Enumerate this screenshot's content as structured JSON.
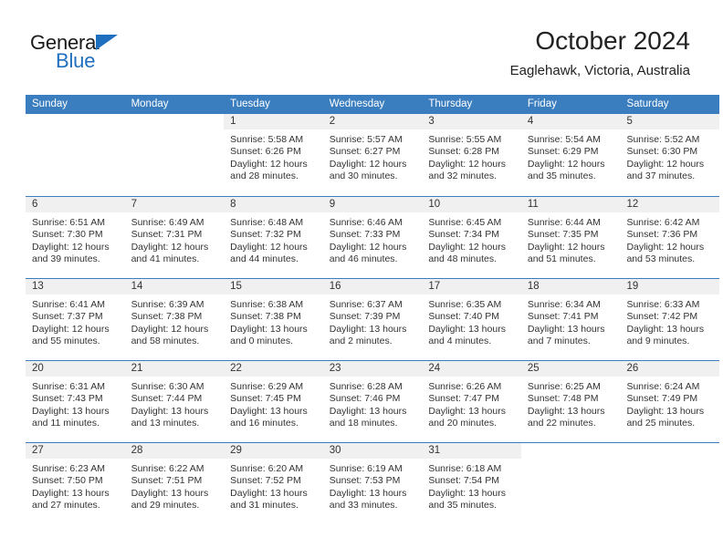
{
  "brand": {
    "name_top": "General",
    "name_bottom": "Blue",
    "triangle_icon": "blue-triangle-icon",
    "accent_color": "#1f6fc0"
  },
  "header": {
    "title": "October 2024",
    "subtitle": "Eaglehawk, Victoria, Australia"
  },
  "colors": {
    "header_blue": "#3b7ec0",
    "date_band_gray": "#f0f0f0",
    "text": "#333333"
  },
  "calendar": {
    "weekdays": [
      "Sunday",
      "Monday",
      "Tuesday",
      "Wednesday",
      "Thursday",
      "Friday",
      "Saturday"
    ],
    "labels": {
      "sunrise": "Sunrise:",
      "sunset": "Sunset:",
      "daylight": "Daylight:"
    },
    "weeks": [
      [
        {
          "day": "",
          "sunrise": "",
          "sunset": "",
          "daylight": "",
          "blank": true
        },
        {
          "day": "",
          "sunrise": "",
          "sunset": "",
          "daylight": "",
          "blank": true
        },
        {
          "day": "1",
          "sunrise": "Sunrise: 5:58 AM",
          "sunset": "Sunset: 6:26 PM",
          "daylight": "Daylight: 12 hours and 28 minutes."
        },
        {
          "day": "2",
          "sunrise": "Sunrise: 5:57 AM",
          "sunset": "Sunset: 6:27 PM",
          "daylight": "Daylight: 12 hours and 30 minutes."
        },
        {
          "day": "3",
          "sunrise": "Sunrise: 5:55 AM",
          "sunset": "Sunset: 6:28 PM",
          "daylight": "Daylight: 12 hours and 32 minutes."
        },
        {
          "day": "4",
          "sunrise": "Sunrise: 5:54 AM",
          "sunset": "Sunset: 6:29 PM",
          "daylight": "Daylight: 12 hours and 35 minutes."
        },
        {
          "day": "5",
          "sunrise": "Sunrise: 5:52 AM",
          "sunset": "Sunset: 6:30 PM",
          "daylight": "Daylight: 12 hours and 37 minutes."
        }
      ],
      [
        {
          "day": "6",
          "sunrise": "Sunrise: 6:51 AM",
          "sunset": "Sunset: 7:30 PM",
          "daylight": "Daylight: 12 hours and 39 minutes."
        },
        {
          "day": "7",
          "sunrise": "Sunrise: 6:49 AM",
          "sunset": "Sunset: 7:31 PM",
          "daylight": "Daylight: 12 hours and 41 minutes."
        },
        {
          "day": "8",
          "sunrise": "Sunrise: 6:48 AM",
          "sunset": "Sunset: 7:32 PM",
          "daylight": "Daylight: 12 hours and 44 minutes."
        },
        {
          "day": "9",
          "sunrise": "Sunrise: 6:46 AM",
          "sunset": "Sunset: 7:33 PM",
          "daylight": "Daylight: 12 hours and 46 minutes."
        },
        {
          "day": "10",
          "sunrise": "Sunrise: 6:45 AM",
          "sunset": "Sunset: 7:34 PM",
          "daylight": "Daylight: 12 hours and 48 minutes."
        },
        {
          "day": "11",
          "sunrise": "Sunrise: 6:44 AM",
          "sunset": "Sunset: 7:35 PM",
          "daylight": "Daylight: 12 hours and 51 minutes."
        },
        {
          "day": "12",
          "sunrise": "Sunrise: 6:42 AM",
          "sunset": "Sunset: 7:36 PM",
          "daylight": "Daylight: 12 hours and 53 minutes."
        }
      ],
      [
        {
          "day": "13",
          "sunrise": "Sunrise: 6:41 AM",
          "sunset": "Sunset: 7:37 PM",
          "daylight": "Daylight: 12 hours and 55 minutes."
        },
        {
          "day": "14",
          "sunrise": "Sunrise: 6:39 AM",
          "sunset": "Sunset: 7:38 PM",
          "daylight": "Daylight: 12 hours and 58 minutes."
        },
        {
          "day": "15",
          "sunrise": "Sunrise: 6:38 AM",
          "sunset": "Sunset: 7:38 PM",
          "daylight": "Daylight: 13 hours and 0 minutes."
        },
        {
          "day": "16",
          "sunrise": "Sunrise: 6:37 AM",
          "sunset": "Sunset: 7:39 PM",
          "daylight": "Daylight: 13 hours and 2 minutes."
        },
        {
          "day": "17",
          "sunrise": "Sunrise: 6:35 AM",
          "sunset": "Sunset: 7:40 PM",
          "daylight": "Daylight: 13 hours and 4 minutes."
        },
        {
          "day": "18",
          "sunrise": "Sunrise: 6:34 AM",
          "sunset": "Sunset: 7:41 PM",
          "daylight": "Daylight: 13 hours and 7 minutes."
        },
        {
          "day": "19",
          "sunrise": "Sunrise: 6:33 AM",
          "sunset": "Sunset: 7:42 PM",
          "daylight": "Daylight: 13 hours and 9 minutes."
        }
      ],
      [
        {
          "day": "20",
          "sunrise": "Sunrise: 6:31 AM",
          "sunset": "Sunset: 7:43 PM",
          "daylight": "Daylight: 13 hours and 11 minutes."
        },
        {
          "day": "21",
          "sunrise": "Sunrise: 6:30 AM",
          "sunset": "Sunset: 7:44 PM",
          "daylight": "Daylight: 13 hours and 13 minutes."
        },
        {
          "day": "22",
          "sunrise": "Sunrise: 6:29 AM",
          "sunset": "Sunset: 7:45 PM",
          "daylight": "Daylight: 13 hours and 16 minutes."
        },
        {
          "day": "23",
          "sunrise": "Sunrise: 6:28 AM",
          "sunset": "Sunset: 7:46 PM",
          "daylight": "Daylight: 13 hours and 18 minutes."
        },
        {
          "day": "24",
          "sunrise": "Sunrise: 6:26 AM",
          "sunset": "Sunset: 7:47 PM",
          "daylight": "Daylight: 13 hours and 20 minutes."
        },
        {
          "day": "25",
          "sunrise": "Sunrise: 6:25 AM",
          "sunset": "Sunset: 7:48 PM",
          "daylight": "Daylight: 13 hours and 22 minutes."
        },
        {
          "day": "26",
          "sunrise": "Sunrise: 6:24 AM",
          "sunset": "Sunset: 7:49 PM",
          "daylight": "Daylight: 13 hours and 25 minutes."
        }
      ],
      [
        {
          "day": "27",
          "sunrise": "Sunrise: 6:23 AM",
          "sunset": "Sunset: 7:50 PM",
          "daylight": "Daylight: 13 hours and 27 minutes."
        },
        {
          "day": "28",
          "sunrise": "Sunrise: 6:22 AM",
          "sunset": "Sunset: 7:51 PM",
          "daylight": "Daylight: 13 hours and 29 minutes."
        },
        {
          "day": "29",
          "sunrise": "Sunrise: 6:20 AM",
          "sunset": "Sunset: 7:52 PM",
          "daylight": "Daylight: 13 hours and 31 minutes."
        },
        {
          "day": "30",
          "sunrise": "Sunrise: 6:19 AM",
          "sunset": "Sunset: 7:53 PM",
          "daylight": "Daylight: 13 hours and 33 minutes."
        },
        {
          "day": "31",
          "sunrise": "Sunrise: 6:18 AM",
          "sunset": "Sunset: 7:54 PM",
          "daylight": "Daylight: 13 hours and 35 minutes."
        },
        {
          "day": "",
          "sunrise": "",
          "sunset": "",
          "daylight": "",
          "blank": true
        },
        {
          "day": "",
          "sunrise": "",
          "sunset": "",
          "daylight": "",
          "blank": true
        }
      ]
    ]
  }
}
